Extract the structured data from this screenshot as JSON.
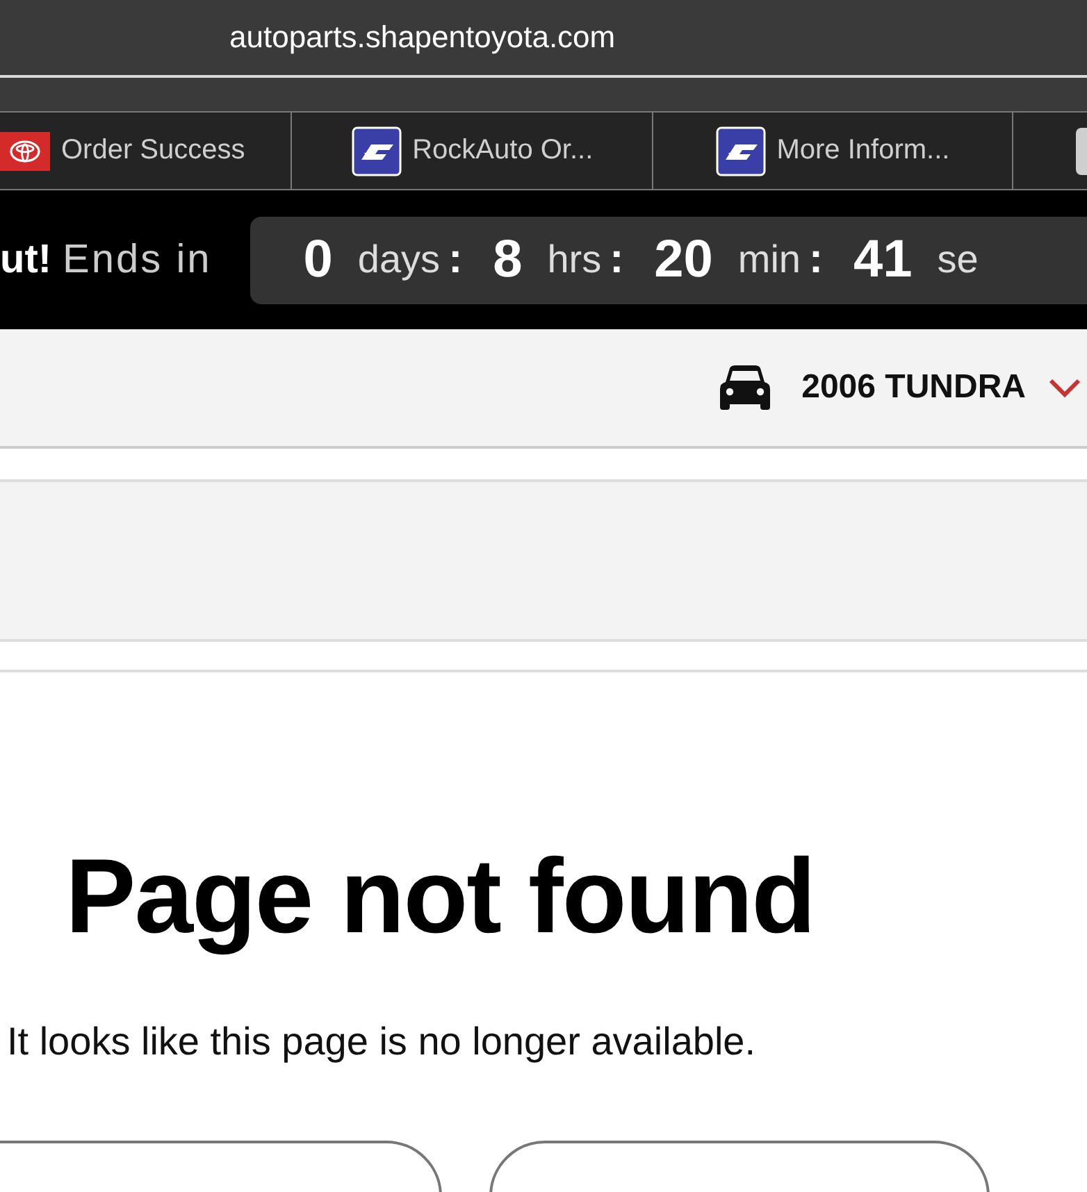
{
  "address_bar": {
    "url": "autoparts.shapentoyota.com"
  },
  "tabs": [
    {
      "label": "Order Success",
      "kind": "toyota",
      "selected": false
    },
    {
      "label": "RockAuto Or...",
      "kind": "rockauto",
      "selected": false
    },
    {
      "label": "More Inform...",
      "kind": "rockauto",
      "selected": false
    }
  ],
  "promo_bar": {
    "lead": "ut!",
    "text": "Ends in",
    "countdown": [
      {
        "value": "0",
        "unit": "days"
      },
      {
        "value": "8",
        "unit": "hrs"
      },
      {
        "value": "20",
        "unit": "min"
      },
      {
        "value": "41",
        "unit": "se"
      }
    ],
    "separator": ":"
  },
  "vehicle": {
    "name": "2006 TUNDRA"
  },
  "error": {
    "title": "Page not found",
    "message": "It looks like this page is no longer available."
  }
}
